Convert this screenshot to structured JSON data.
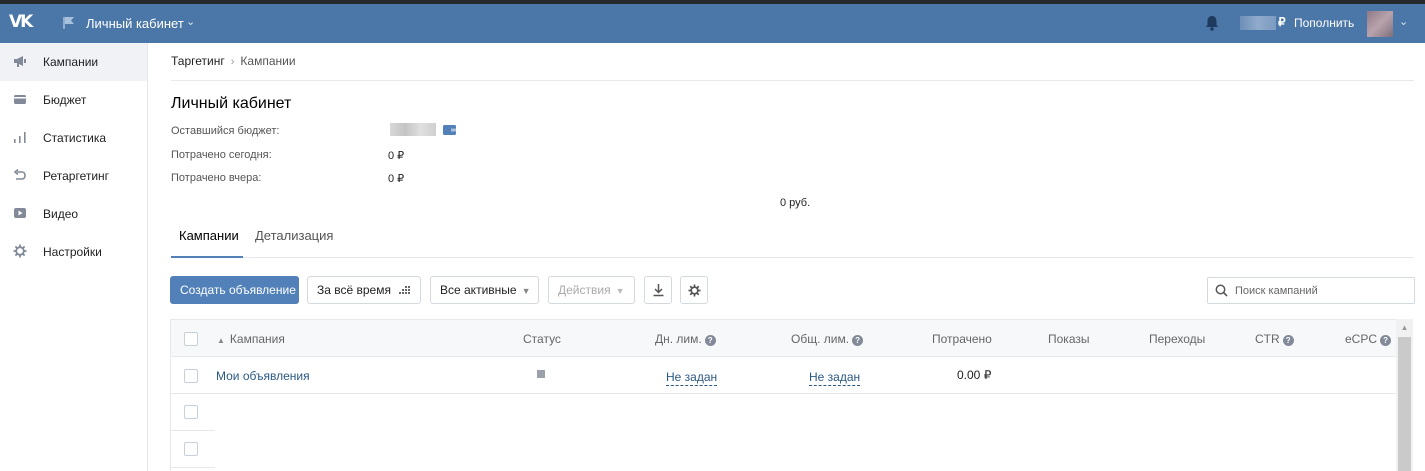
{
  "topbar": {
    "logo": "VK",
    "cabinet_title": "Личный кабинет",
    "currency": "₽",
    "topup_label": "Пополнить"
  },
  "sidebar": {
    "items": [
      {
        "label": "Кампании",
        "icon": "megaphone-icon",
        "active": true
      },
      {
        "label": "Бюджет",
        "icon": "wallet-icon",
        "active": false
      },
      {
        "label": "Статистика",
        "icon": "bar-chart-icon",
        "active": false
      },
      {
        "label": "Ретаргетинг",
        "icon": "return-arrow-icon",
        "active": false
      },
      {
        "label": "Видео",
        "icon": "play-icon",
        "active": false
      },
      {
        "label": "Настройки",
        "icon": "gear-icon",
        "active": false
      }
    ]
  },
  "breadcrumb": {
    "root": "Таргетинг",
    "separator": "›",
    "current": "Кампании"
  },
  "page": {
    "title": "Личный кабинет",
    "remaining_budget_label": "Оставшийся бюджет:",
    "spent_today_label": "Потрачено сегодня:",
    "spent_today_value": "0 ₽",
    "spent_yesterday_label": "Потрачено вчера:",
    "spent_yesterday_value": "0 ₽",
    "total_rub": "0 руб."
  },
  "tabs": [
    {
      "label": "Кампании",
      "active": true
    },
    {
      "label": "Детализация",
      "active": false
    }
  ],
  "toolbar": {
    "create_label": "Создать объявление",
    "period_label": "За всё время",
    "filter_label": "Все активные",
    "actions_label": "Действия",
    "search_placeholder": "Поиск кампаний"
  },
  "table": {
    "columns": {
      "campaign": "Кампания",
      "status": "Статус",
      "day_limit": "Дн. лим.",
      "total_limit": "Общ. лим.",
      "spent": "Потрачено",
      "impressions": "Показы",
      "clicks": "Переходы",
      "ctr": "CTR",
      "ecpc": "eCPC"
    },
    "rows": [
      {
        "campaign": "Мои объявления",
        "day_limit": "Не задан",
        "total_limit": "Не задан",
        "spent": "0.00 ₽"
      }
    ]
  },
  "colors": {
    "header_bg": "#4a76a8",
    "primary_button": "#5181b8",
    "link": "#2a5885"
  }
}
